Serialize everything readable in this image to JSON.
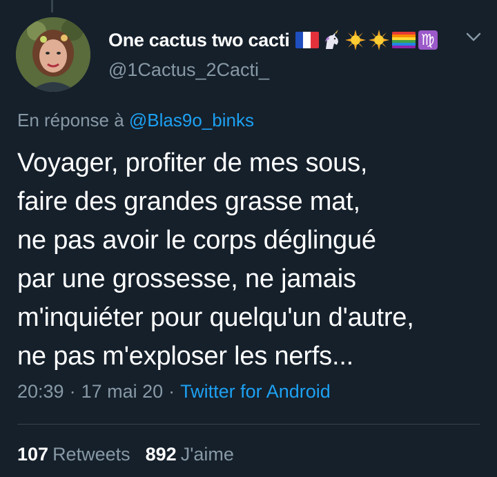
{
  "author": {
    "display_name": "One cactus two cacti",
    "handle": "@1Cactus_2Cacti_",
    "name_emojis": [
      "flag-france",
      "unicorn",
      "sun",
      "sun",
      "rainbow-flag",
      "virgo"
    ]
  },
  "reply": {
    "prefix": "En réponse à",
    "mention": "@Blas9o_binks"
  },
  "tweet": {
    "text": "Voyager, profiter de mes sous,\nfaire des grandes grasse mat,\nne pas avoir le corps déglingué\npar une grossesse, ne jamais\nm'inquiéter pour quelqu'un d'autre,\nne pas m'exploser les nerfs..."
  },
  "meta": {
    "time": "20:39",
    "sep1": "·",
    "date": "17 mai 20",
    "sep2": "·",
    "source": "Twitter for Android"
  },
  "stats": {
    "retweets_count": "107",
    "retweets_label": "Retweets",
    "likes_count": "892",
    "likes_label": "J'aime"
  },
  "colors": {
    "background": "#15202b",
    "accent": "#1da1f2",
    "muted": "#8899a6"
  }
}
